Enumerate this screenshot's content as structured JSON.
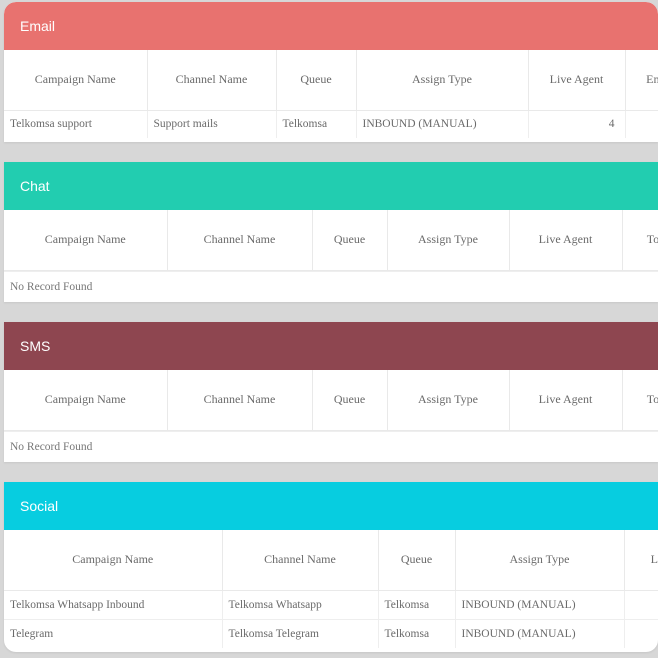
{
  "colors": {
    "email": "#e8726f",
    "chat": "#22cdb0",
    "sms": "#8e4650",
    "social": "#07cde0"
  },
  "email": {
    "title": "Email",
    "headers": [
      "Campaign Name",
      "Channel Name",
      "Queue",
      "Assign Type",
      "Live Agent",
      "Em"
    ],
    "rows": [
      [
        "Telkomsa support",
        "Support mails",
        "Telkomsa",
        "INBOUND (MANUAL)",
        "4",
        ""
      ]
    ]
  },
  "chat": {
    "title": "Chat",
    "headers": [
      "Campaign Name",
      "Channel Name",
      "Queue",
      "Assign Type",
      "Live Agent",
      "To"
    ],
    "empty_text": "No Record Found"
  },
  "sms": {
    "title": "SMS",
    "headers": [
      "Campaign Name",
      "Channel Name",
      "Queue",
      "Assign Type",
      "Live Agent",
      "To"
    ],
    "empty_text": "No Record Found"
  },
  "social": {
    "title": "Social",
    "headers": [
      "Campaign Name",
      "Channel Name",
      "Queue",
      "Assign Type",
      "Liv"
    ],
    "rows": [
      [
        "Telkomsa Whatsapp Inbound",
        "Telkomsa Whatsapp",
        "Telkomsa",
        "INBOUND (MANUAL)",
        ""
      ],
      [
        "Telegram",
        "Telkomsa Telegram",
        "Telkomsa",
        "INBOUND (MANUAL)",
        ""
      ]
    ]
  }
}
